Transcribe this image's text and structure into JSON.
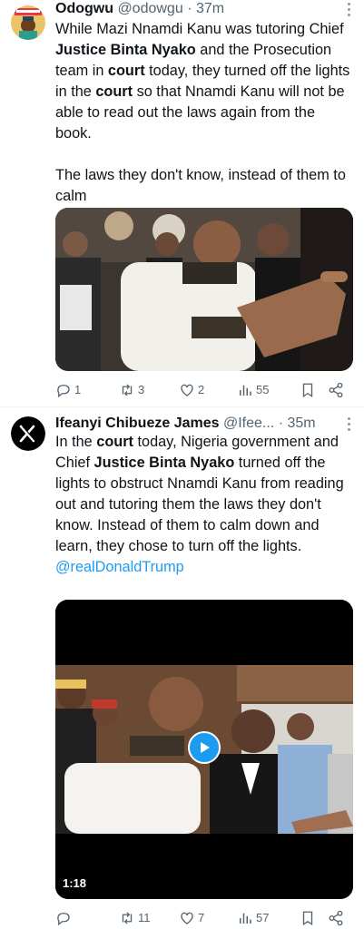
{
  "tweets": [
    {
      "author": {
        "name": "Odogwu",
        "handle": "@odowgu",
        "time": "· 37m"
      },
      "paragraphs": [
        [
          {
            "text": "While Mazi Nnamdi Kanu was tutoring Chief "
          },
          {
            "text": "Justice Binta Nyako",
            "bold": true
          },
          {
            "text": " and the Prosecution team in "
          },
          {
            "text": "court",
            "bold": true
          },
          {
            "text": " today, they turned off the lights in the "
          },
          {
            "text": "court",
            "bold": true
          },
          {
            "text": " so that Nnamdi Kanu will not be able to read out the laws again from the book."
          }
        ],
        [
          {
            "text": "The laws they don't know, instead of them to calm"
          }
        ]
      ],
      "stats": {
        "replies": "1",
        "reposts": "3",
        "likes": "2",
        "views": "55"
      }
    },
    {
      "author": {
        "name": "Ifeanyi Chibueze James",
        "handle": "@Ifee...",
        "time": "· 35m"
      },
      "paragraphs": [
        [
          {
            "text": "In the "
          },
          {
            "text": "court",
            "bold": true
          },
          {
            "text": " today, Nigeria government and Chief "
          },
          {
            "text": "Justice Binta Nyako",
            "bold": true
          },
          {
            "text": " turned off the lights to obstruct Nnamdi Kanu from reading out and tutoring them the laws they don't know. Instead of them to calm down and learn, they chose to turn off the lights."
          }
        ],
        [
          {
            "text": "@realDonaldTrump",
            "mention": true
          }
        ]
      ],
      "video_duration": "1:18",
      "stats": {
        "replies": "",
        "reposts": "11",
        "likes": "7",
        "views": "57"
      }
    }
  ],
  "colors": {
    "text": "#0f1419",
    "secondary": "#536471",
    "link": "#1d9bf0",
    "divider": "#eff3f4"
  },
  "icons": [
    "more-icon",
    "reply-icon",
    "repost-icon",
    "like-icon",
    "views-icon",
    "bookmark-icon",
    "share-icon",
    "play-icon"
  ]
}
